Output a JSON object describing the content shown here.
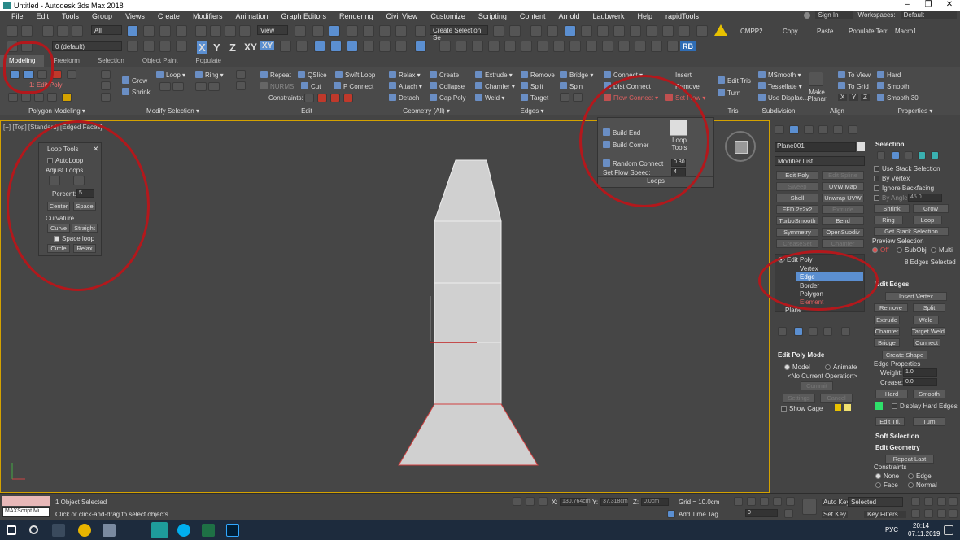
{
  "window": {
    "title": "Untitled - Autodesk 3ds Max 2018"
  },
  "menu": [
    "File",
    "Edit",
    "Tools",
    "Group",
    "Views",
    "Create",
    "Modifiers",
    "Animation",
    "Graph Editors",
    "Rendering",
    "Civil View",
    "Customize",
    "Scripting",
    "Content",
    "Arnold",
    "Laubwerk",
    "Help",
    "rapidTools"
  ],
  "account": {
    "signin": "Sign In",
    "workspaces_label": "Workspaces:",
    "workspace": "Default"
  },
  "toolbar": {
    "all": "All",
    "layer": "0 (default)",
    "view": "View",
    "selection_set": "Create Selection Se",
    "custom": [
      "CMPP2",
      "Copy",
      "Paste",
      "Populate:Terr",
      "Macro1"
    ],
    "axis_x": "X",
    "axis_y": "Y",
    "axis_z": "Z",
    "axis_xy": "XY",
    "axis_xy2": "XY",
    "rb": "RB"
  },
  "tabs": [
    "Modeling",
    "Freeform",
    "Selection",
    "Object Paint",
    "Populate"
  ],
  "ribbon": {
    "edit_poly": "1: Edit Poly",
    "polygon_modeling": "Polygon Modeling ▾",
    "grow": "Grow",
    "shrink": "Shrink",
    "loop": "Loop",
    "ring": "Ring",
    "modify_selection": "Modify Selection ▾",
    "repeat": "Repeat",
    "qslice": "QSlice",
    "swift_loop": "Swift Loop",
    "nurms": "NURMS",
    "cut": "Cut",
    "p_connect": "P Connect",
    "constraints": "Constraints:",
    "edit": "Edit",
    "relax": "Relax",
    "create": "Create",
    "attach": "Attach",
    "collapse": "Collapse",
    "detach": "Detach",
    "cap_poly": "Cap Poly",
    "geometry_all": "Geometry (All) ▾",
    "extrude": "Extrude",
    "remove": "Remove",
    "bridge": "Bridge",
    "chamfer": "Chamfer",
    "split": "Split",
    "spin": "Spin",
    "weld": "Weld",
    "target": "Target",
    "edges": "Edges ▾",
    "connect": "Connect",
    "insert": "Insert",
    "dist_connect": "Dist Connect",
    "remove2": "Remove",
    "flow_connect": "Flow Connect",
    "set_flow": "Set Flow",
    "edit_tris": "Edit Tris",
    "turn": "Turn",
    "tris": "Tris",
    "msmooth": "MSmooth",
    "tessellate": "Tessellate",
    "use_displac": "Use Displac...",
    "subdivision": "Subdivision",
    "make_planar": "Make Planar",
    "to_view": "To View",
    "to_grid": "To Grid",
    "x": "X",
    "y": "Y",
    "z": "Z",
    "align": "Align",
    "hard": "Hard",
    "smooth": "Smooth",
    "smooth30": "Smooth 30",
    "properties": "Properties ▾"
  },
  "loops_popup": {
    "build_end": "Build End",
    "build_corner": "Build Corner",
    "loop_tools": "Loop Tools",
    "random_connect": "Random Connect",
    "random_value": "0.30",
    "set_flow_speed": "Set Flow Speed:",
    "speed_value": "4",
    "title": "Loops"
  },
  "viewport": {
    "label": "[+] [Top] [Standard] [Edged Faces]"
  },
  "loop_tools_panel": {
    "title": "Loop Tools",
    "autoloop": "AutoLoop",
    "adjust_loops": "Adjust Loops",
    "percent_label": "Percent:",
    "percent_value": "5",
    "center": "Center",
    "space": "Space",
    "curvature": "Curvature",
    "curve": "Curve",
    "straight": "Straight",
    "space_loop": "Space loop",
    "circle": "Circle",
    "relax": "Relax"
  },
  "command_panel": {
    "object_name": "Plane001",
    "modifier_list": "Modifier List",
    "mod_buttons": [
      "Edit Poly",
      "Edit Spline",
      "Sweep",
      "UVW Map",
      "Shell",
      "Unwrap UVW",
      "FFD 2x2x2",
      "Extrude",
      "TurboSmooth",
      "Bend",
      "Symmetry",
      "OpenSubdiv",
      "CreaseSet",
      "Chamfer"
    ],
    "stack": [
      "Edit Poly",
      "Vertex",
      "Edge",
      "Border",
      "Polygon",
      "Element",
      "Plane"
    ],
    "edit_poly_mode": "Edit Poly Mode",
    "model": "Model",
    "animate": "Animate",
    "no_op": "<No Current Operation>",
    "commit": "Commit",
    "settings": "Settings",
    "cancel": "Cancel",
    "show_cage": "Show Cage",
    "selection": "Selection",
    "use_stack": "Use Stack Selection",
    "by_vertex": "By Vertex",
    "ignore_backfacing": "Ignore Backfacing",
    "by_angle": "By Angle:",
    "angle_value": "45.0",
    "shrink": "Shrink",
    "grow": "Grow",
    "ring": "Ring",
    "loop": "Loop",
    "get_stack": "Get Stack Selection",
    "preview_selection": "Preview Selection",
    "off": "Off",
    "subobj": "SubObj",
    "multi": "Multi",
    "edges_selected": "8 Edges Selected",
    "edit_edges": "Edit Edges",
    "insert_vertex": "Insert Vertex",
    "remove": "Remove",
    "split": "Split",
    "extrude": "Extrude",
    "weld": "Weld",
    "chamfer": "Chamfer",
    "target_weld": "Target Weld",
    "bridge": "Bridge",
    "connect": "Connect",
    "create_shape": "Create Shape",
    "edge_properties": "Edge Properties",
    "weight_label": "Weight:",
    "weight_value": "1.0",
    "crease_label": "Crease:",
    "crease_value": "0.0",
    "hard": "Hard",
    "smooth": "Smooth",
    "display_hard": "Display Hard Edges",
    "edit_tri": "Edit Tri.",
    "turn": "Turn",
    "soft_selection": "Soft Selection",
    "edit_geometry": "Edit Geometry",
    "repeat_last": "Repeat Last",
    "constraints": "Constraints",
    "none": "None",
    "edge": "Edge",
    "face": "Face",
    "normal": "Normal"
  },
  "status": {
    "maxscript": "MAXScript Mi",
    "selected": "1 Object Selected",
    "hint": "Click or click-and-drag to select objects",
    "x_label": "X:",
    "x_value": "130.764cm",
    "y_label": "Y:",
    "y_value": "37.318cm",
    "z_label": "Z:",
    "z_value": "0.0cm",
    "grid": "Grid = 10.0cm",
    "add_time_tag": "Add Time Tag",
    "autokey": "Auto Key",
    "setkey": "Set Key",
    "selected_dd": "Selected",
    "key_filters": "Key Filters...",
    "frame": "0"
  },
  "taskbar": {
    "lang": "РУС",
    "time": "20:14",
    "date": "07.11.2019"
  },
  "colors": {
    "accent": "#5b8fd1",
    "annotation": "#b3181c",
    "viewport_border": "#d4a200"
  }
}
